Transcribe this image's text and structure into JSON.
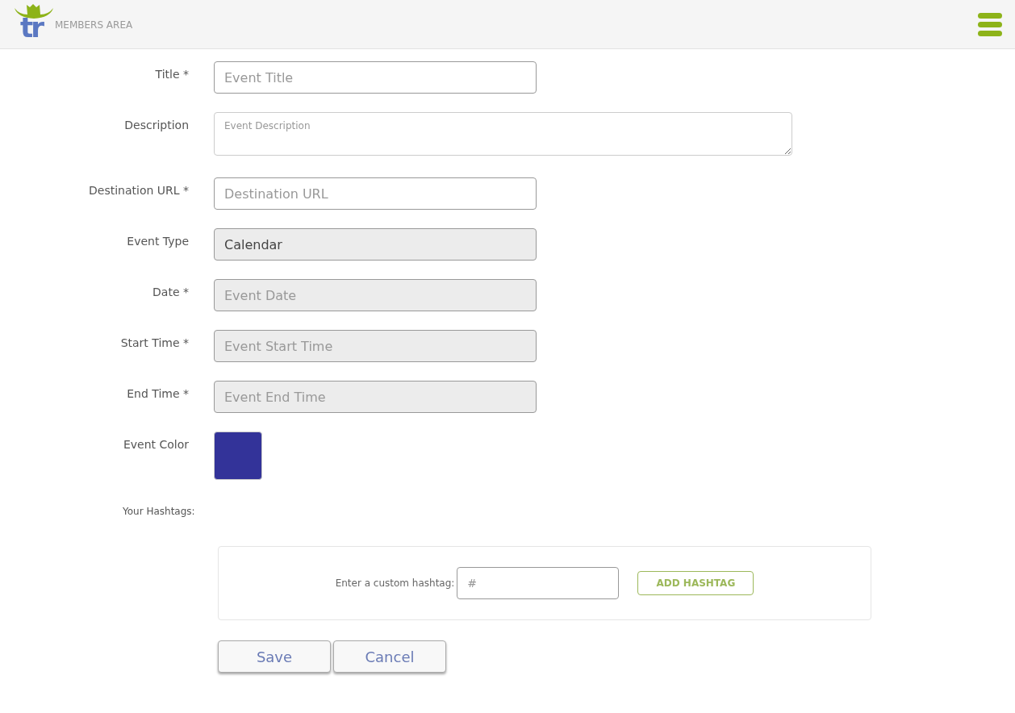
{
  "header": {
    "logo_text": "tr",
    "title": "MEMBERS AREA"
  },
  "fields": [
    {
      "kind": "input",
      "label": "Title *",
      "placeholder": "Event Title",
      "disabled": false
    },
    {
      "kind": "textarea",
      "label": "Description",
      "placeholder": "Event Description",
      "disabled": false
    },
    {
      "kind": "input",
      "label": "Destination URL *",
      "placeholder": "Destination URL",
      "disabled": false
    },
    {
      "kind": "input",
      "label": "Event Type",
      "value": "Calendar",
      "disabled": true
    },
    {
      "kind": "input",
      "label": "Date *",
      "placeholder": "Event Date",
      "disabled": true
    },
    {
      "kind": "input",
      "label": "Start Time *",
      "placeholder": "Event Start Time",
      "disabled": true
    },
    {
      "kind": "input",
      "label": "End Time *",
      "placeholder": "Event End Time",
      "disabled": true
    },
    {
      "kind": "color",
      "label": "Event Color",
      "color": "#333399"
    }
  ],
  "hashtags": {
    "label": "Your Hashtags:",
    "custom_label": "Enter a custom hashtag:",
    "placeholder": "#",
    "add_button": "ADD HASHTAG"
  },
  "buttons": [
    "Save",
    "Cancel"
  ]
}
